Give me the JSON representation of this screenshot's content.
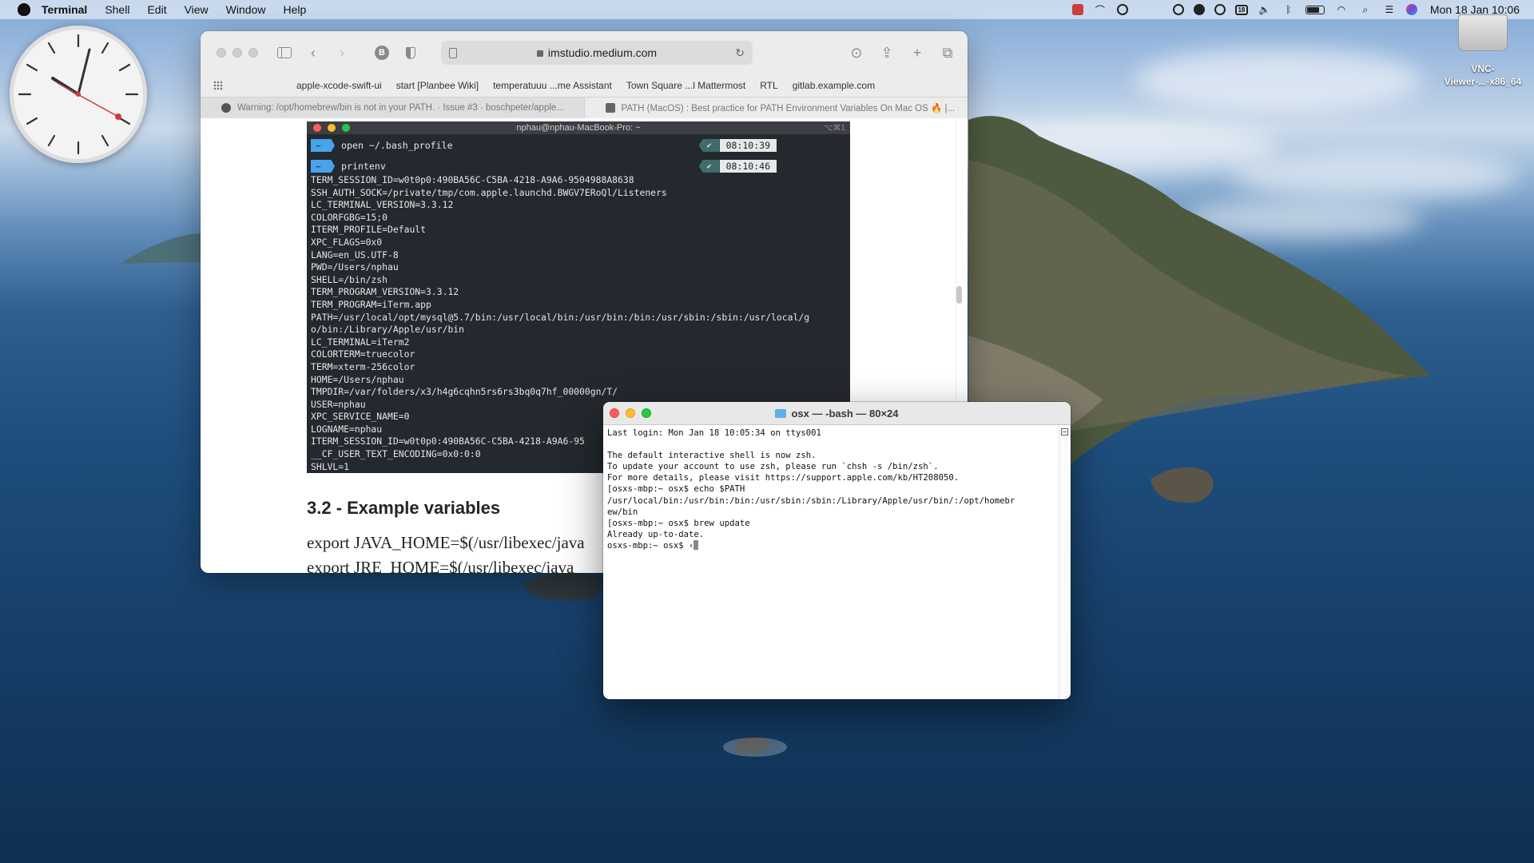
{
  "menubar": {
    "app": "Terminal",
    "items": [
      "Shell",
      "Edit",
      "View",
      "Window",
      "Help"
    ],
    "clock": "Mon 18 Jan  10:06",
    "calendar_day": "18",
    "icons": [
      "red-app-icon",
      "arc-icon",
      "power-icon",
      "vnc-icon",
      "moon-icon",
      "creative-cloud-icon",
      "calendar-icon",
      "volume-icon",
      "bluetooth-icon",
      "battery-icon",
      "wifi-icon",
      "search-icon",
      "control-center-icon",
      "siri-icon"
    ]
  },
  "desktop": {
    "disk_label_line1": "VNC-",
    "disk_label_line2": "Viewer-...-x86_64"
  },
  "safari": {
    "url": "imstudio.medium.com",
    "bookmarks": [
      "apple-xcode-swift-ui",
      "start [Planbee Wiki]",
      "temperatuuu ...me Assistant",
      "Town Square ...l Mattermost",
      "RTL",
      "gitlab.example.com"
    ],
    "tabs": [
      {
        "title": "Warning: /opt/homebrew/bin is not in your PATH. · Issue #3 · boschpeter/apple..."
      },
      {
        "title": "PATH (MacOS) : Best practice for PATH Environment Variables On Mac OS 🔥 |..."
      }
    ],
    "screenshot": {
      "title": "nphau@nphau-MacBook-Pro: ~",
      "shortcut": "⌥⌘1",
      "cmd1": "open ~/.bash_profile",
      "time1": "08:10:39",
      "cmd2": "printenv",
      "time2": "08:10:46",
      "prompt_glyph": "~",
      "check_glyph": "✔",
      "output": "TERM_SESSION_ID=w0t0p0:490BA56C-C5BA-4218-A9A6-9504988A8638\nSSH_AUTH_SOCK=/private/tmp/com.apple.launchd.BWGV7ERoQl/Listeners\nLC_TERMINAL_VERSION=3.3.12\nCOLORFGBG=15;0\nITERM_PROFILE=Default\nXPC_FLAGS=0x0\nLANG=en_US.UTF-8\nPWD=/Users/nphau\nSHELL=/bin/zsh\nTERM_PROGRAM_VERSION=3.3.12\nTERM_PROGRAM=iTerm.app\nPATH=/usr/local/opt/mysql@5.7/bin:/usr/local/bin:/usr/bin:/bin:/usr/sbin:/sbin:/usr/local/g\no/bin:/Library/Apple/usr/bin\nLC_TERMINAL=iTerm2\nCOLORTERM=truecolor\nTERM=xterm-256color\nHOME=/Users/nphau\nTMPDIR=/var/folders/x3/h4g6cqhn5rs6rs3bq0q7hf_00000gn/T/\nUSER=nphau\nXPC_SERVICE_NAME=0\nLOGNAME=nphau\nITERM_SESSION_ID=w0t0p0:490BA56C-C5BA-4218-A9A6-95\n__CF_USER_TEXT_ENCODING=0x0:0:0\nSHLVL=1"
    },
    "heading": "3.2 - Example variables",
    "paragraph": "export JAVA_HOME=$(/usr/libexec/java",
    "paragraph2": "export JRE_HOME=$(/usr/libexec/java"
  },
  "terminal": {
    "title": "osx — -bash — 80×24",
    "content": "Last login: Mon Jan 18 10:05:34 on ttys001\n\nThe default interactive shell is now zsh.\nTo update your account to use zsh, please run `chsh -s /bin/zsh`.\nFor more details, please visit https://support.apple.com/kb/HT208050.\n[osxs-mbp:~ osx$ echo $PATH\n/usr/local/bin:/usr/bin:/bin:/usr/sbin:/sbin:/Library/Apple/usr/bin/:/opt/homebr\new/bin\n[osxs-mbp:~ osx$ brew update\nAlready up-to-date.\nosxs-mbp:~ osx$ ‹"
  }
}
